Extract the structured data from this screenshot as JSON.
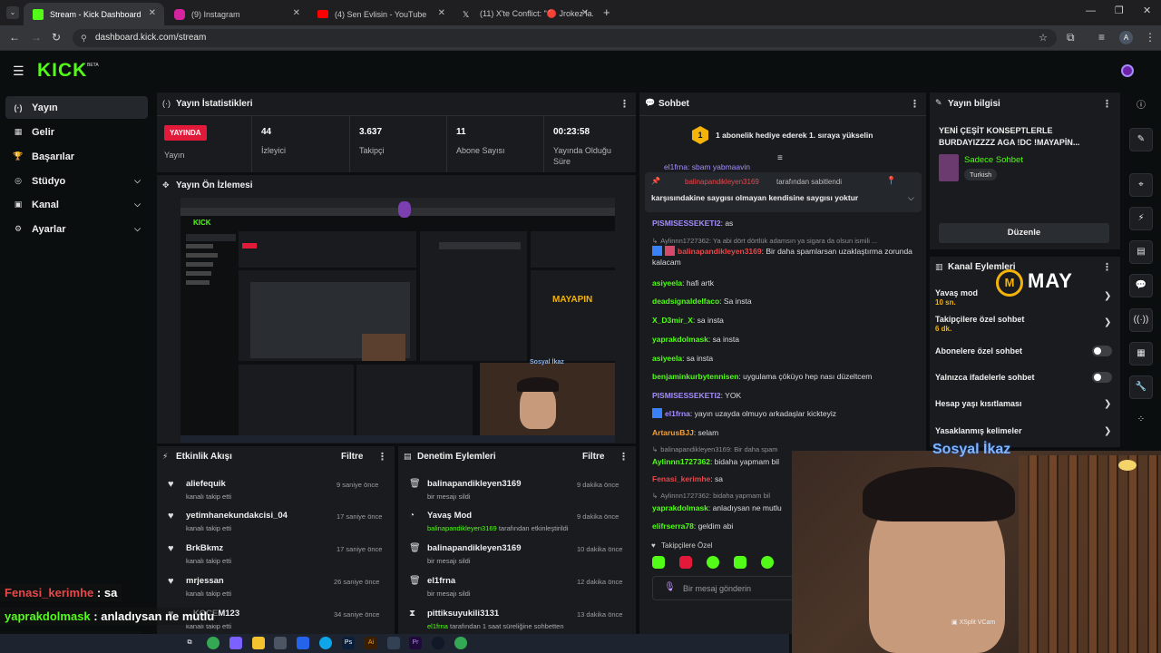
{
  "browser": {
    "tabs": [
      {
        "title": "Stream - Kick Dashboard",
        "color": "#53fc18"
      },
      {
        "title": "(9) Instagram",
        "color": "#d6249f"
      },
      {
        "title": "(4) Sen Evlisin - YouTube",
        "color": "#ff0000"
      },
      {
        "title": "(11) X'te Conflict: \"🔴 Jrokez la...",
        "color": "#e7e7e7"
      }
    ],
    "url": "dashboard.kick.com/stream",
    "profile_initial": "A"
  },
  "brand": {
    "logo": "KICK",
    "badge": "BETA",
    "accent": "#53fc18"
  },
  "sidebar": {
    "items": [
      {
        "label": "Yayın",
        "icon": "(·)"
      },
      {
        "label": "Gelir",
        "icon": "▦"
      },
      {
        "label": "Başarılar",
        "icon": "🏆"
      },
      {
        "label": "Stüdyo",
        "icon": "◎"
      },
      {
        "label": "Kanal",
        "icon": "▣"
      },
      {
        "label": "Ayarlar",
        "icon": "⚙"
      }
    ]
  },
  "stats": {
    "title": "Yayın İstatistikleri",
    "live_badge": "YAYINDA",
    "live_label": "Yayın",
    "viewers": {
      "value": "44",
      "label": "İzleyici"
    },
    "followers": {
      "value": "3.637",
      "label": "Takipçi"
    },
    "subs": {
      "value": "11",
      "label": "Abone Sayısı"
    },
    "duration": {
      "value": "00:23:58",
      "label": "Yayında Olduğu Süre"
    }
  },
  "preview": {
    "title": "Yayın Ön İzlemesi"
  },
  "activity": {
    "title": "Etkinlik Akışı",
    "filter": "Filtre",
    "items": [
      {
        "name": "aliefequik",
        "sub": "kanalı takip etti",
        "time": "9 saniye önce"
      },
      {
        "name": "yetimhanekundakcisi_04",
        "sub": "kanalı takip etti",
        "time": "17 saniye önce"
      },
      {
        "name": "BrkBkmz",
        "sub": "kanalı takip etti",
        "time": "17 saniye önce"
      },
      {
        "name": "mrjessan",
        "sub": "kanalı takip etti",
        "time": "26 saniye önce"
      },
      {
        "name": "...KOCEM123",
        "sub": "kanalı takip etti",
        "time": "34 saniye önce"
      }
    ]
  },
  "moderation": {
    "title": "Denetim Eylemleri",
    "filter": "Filtre",
    "items": [
      {
        "name": "balinapandikleyen3169",
        "sub": "bir mesajı sildi",
        "time": "9 dakika önce",
        "icon": "🗑"
      },
      {
        "name": "Yavaş Mod",
        "sub_user": "balinapandikleyen3169",
        "sub": " tarafından etkinleştirildi",
        "time": "9 dakika önce",
        "icon": "◔"
      },
      {
        "name": "balinapandikleyen3169",
        "sub": "bir mesajı sildi",
        "time": "10 dakika önce",
        "icon": "🗑"
      },
      {
        "name": "el1frna",
        "sub": "bir mesajı sildi",
        "time": "12 dakika önce",
        "icon": "🗑"
      },
      {
        "name": "pittiksuyukili3131",
        "sub_user": "el1frna",
        "sub": " tarafından 1 saat süreliğine sohbetten",
        "time": "13 dakika önce",
        "icon": "⧗"
      }
    ]
  },
  "chat": {
    "title": "Sohbet",
    "gift_banner": "1 abonelik hediye ederek 1. sıraya yükselin",
    "gift_rank": "1",
    "pinned_user": "balinapandikleyen3169",
    "pinned_by": "tarafından sabitlendi",
    "pinned_text": "karşısındakine saygısı olmayan kendisine saygısı yoktur",
    "top_partial": "el1frna: sbam yabmaavin",
    "messages": [
      {
        "user": "PISMISESSEKETI2",
        "color": "#a58cff",
        "text": ": as"
      },
      {
        "user": "Aylinnn1727362",
        "color": "#8f8f8f",
        "text": ": Ya abi dört dörtlük adamsın ya sigara da olsun ismili ...",
        "reply": true
      },
      {
        "user": "balinapandikleyen3169",
        "color": "#e8484b",
        "text": ": Bir daha spamlarsan uzaklaştırma zorunda kalacam",
        "badges": true
      },
      {
        "user": "asiyeela",
        "color": "#53fc18",
        "text": ": hafi artk"
      },
      {
        "user": "deadsignaldelfaco",
        "color": "#53fc18",
        "text": ": Sa insta"
      },
      {
        "user": "X_D3mir_X",
        "color": "#53fc18",
        "text": ": sa insta"
      },
      {
        "user": "yaprakdolmask",
        "color": "#53fc18",
        "text": ": sa insta"
      },
      {
        "user": "asiyeela",
        "color": "#53fc18",
        "text": ": sa insta"
      },
      {
        "user": "benjaminkurbytennisen",
        "color": "#53fc18",
        "text": ": uygulama çöküyo hep nası düzeltcem"
      },
      {
        "user": "PISMISESSEKETI2",
        "color": "#a58cff",
        "text": ": YOK"
      },
      {
        "user": "el1frna",
        "color": "#a58cff",
        "text": ": yayın uzayda olmuyo arkadaşlar kickteyiz",
        "badges": true
      },
      {
        "user": "ArtarusBJJ",
        "color": "#f2a03d",
        "text": ": selam"
      },
      {
        "user": "balinapandikleyen3169",
        "color": "#8f8f8f",
        "text": ": Bir daha spam",
        "reply": true
      },
      {
        "user": "Aylinnn1727362",
        "color": "#53fc18",
        "text": ": bidaha yapmam bil"
      },
      {
        "user": "Fenasi_kerimhe",
        "color": "#e8484b",
        "text": ": sa"
      },
      {
        "user": "Aylinnn1727362",
        "color": "#8f8f8f",
        "text": ": bidaha yapmam bil",
        "reply": true
      },
      {
        "user": "yaprakdolmask",
        "color": "#53fc18",
        "text": ": anladıysan ne mutlu"
      },
      {
        "user": "elifrserra78",
        "color": "#53fc18",
        "text": ": geldim abi"
      }
    ],
    "mode_label": "Takipçilere Özel",
    "input_placeholder": "Bir mesaj gönderin"
  },
  "stream_info": {
    "title": "Yayın bilgisi",
    "stream_title": "YENİ ÇEŞİT KONSEPTLERLE BURDAYIZZZZ AGA !DC !MAYAPİN...",
    "category": "Sadece Sohbet",
    "tag": "Turkish",
    "edit_button": "Düzenle"
  },
  "channel_actions": {
    "title": "Kanal Eylemleri",
    "items": [
      {
        "label": "Yavaş mod",
        "sub": "10 sn.",
        "kind": "chevron"
      },
      {
        "label": "Takipçilere özel sohbet",
        "sub": "6 dk.",
        "kind": "chevron"
      },
      {
        "label": "Abonelere özel sohbet",
        "kind": "toggle"
      },
      {
        "label": "Yalnızca ifadelerle sohbet",
        "kind": "toggle"
      },
      {
        "label": "Hesap yaşı kısıtlaması",
        "kind": "chevron"
      },
      {
        "label": "Yasaklanmış kelimeler",
        "kind": "chevron"
      }
    ]
  },
  "overlay": {
    "webcam_banner": "Sosyal İkaz",
    "webcam_tag": "XSplit VCam",
    "brand_text": "MAY",
    "chat_lines": [
      {
        "user": "Fenasi_kerimhe",
        "color": "#e8484b",
        "text": " : sa"
      },
      {
        "user": "yaprakdolmask",
        "color": "#53fc18",
        "text": " : anladıysan ne mutlu"
      },
      {
        "user": "elifrserra78",
        "color": "#53fc18",
        "text": " : geldim abi"
      }
    ]
  }
}
